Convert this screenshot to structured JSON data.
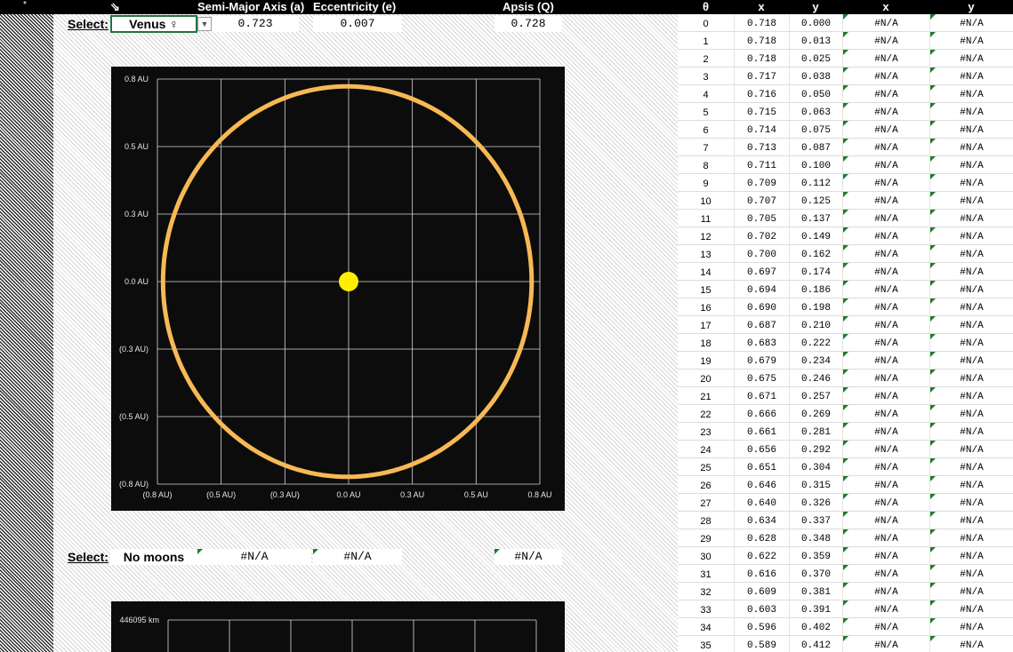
{
  "header": {
    "star": "*",
    "arrow": "⇘",
    "semi_major": "Semi-Major Axis (a)",
    "eccentricity": "Eccentricity (e)",
    "apsis": "Apsis (Q)",
    "col_theta": "θ",
    "col_x": "x",
    "col_y": "y",
    "col_x2": "x",
    "col_y2": "y"
  },
  "planet_row": {
    "select_label": "Select:",
    "selected": "Venus ♀",
    "a": "0.723",
    "e": "0.007",
    "Q": "0.728"
  },
  "moon_row": {
    "select_label": "Select:",
    "selected": "No moons",
    "a": "#N/A",
    "e": "#N/A",
    "Q": "#N/A"
  },
  "chart_data": [
    {
      "type": "scatter",
      "title": "",
      "xlabel": "",
      "ylabel": "",
      "xlim": [
        -0.75,
        0.75
      ],
      "ylim": [
        -0.75,
        0.75
      ],
      "x_ticks": [
        -0.75,
        -0.5,
        -0.25,
        0,
        0.25,
        0.5,
        0.75
      ],
      "y_ticks": [
        -0.75,
        -0.5,
        -0.25,
        0,
        0.25,
        0.5,
        0.75
      ],
      "x_tick_labels": [
        "(0.8 AU)",
        "(0.5 AU)",
        "(0.3 AU)",
        "0.0 AU",
        "0.3 AU",
        "0.5 AU",
        "0.8 AU"
      ],
      "y_tick_labels": [
        "(0.8 AU)",
        "(0.5 AU)",
        "(0.3 AU)",
        "0.0 AU",
        "0.3 AU",
        "0.5 AU",
        "0.8 AU"
      ],
      "grid": true,
      "series": [
        {
          "semi_major_axis": 0.723,
          "eccentricity": 0.007,
          "color": "#f7b955"
        },
        {
          "x": [
            0
          ],
          "y": [
            0
          ],
          "color": "#ffee00"
        }
      ]
    },
    {
      "type": "scatter",
      "title": "",
      "y_tick_labels": [
        "446095 km"
      ],
      "grid": true,
      "series": []
    }
  ],
  "table": {
    "rows": [
      {
        "t": "0",
        "x": "0.718",
        "y": "0.000",
        "x2": "#N/A",
        "y2": "#N/A"
      },
      {
        "t": "1",
        "x": "0.718",
        "y": "0.013",
        "x2": "#N/A",
        "y2": "#N/A"
      },
      {
        "t": "2",
        "x": "0.718",
        "y": "0.025",
        "x2": "#N/A",
        "y2": "#N/A"
      },
      {
        "t": "3",
        "x": "0.717",
        "y": "0.038",
        "x2": "#N/A",
        "y2": "#N/A"
      },
      {
        "t": "4",
        "x": "0.716",
        "y": "0.050",
        "x2": "#N/A",
        "y2": "#N/A"
      },
      {
        "t": "5",
        "x": "0.715",
        "y": "0.063",
        "x2": "#N/A",
        "y2": "#N/A"
      },
      {
        "t": "6",
        "x": "0.714",
        "y": "0.075",
        "x2": "#N/A",
        "y2": "#N/A"
      },
      {
        "t": "7",
        "x": "0.713",
        "y": "0.087",
        "x2": "#N/A",
        "y2": "#N/A"
      },
      {
        "t": "8",
        "x": "0.711",
        "y": "0.100",
        "x2": "#N/A",
        "y2": "#N/A"
      },
      {
        "t": "9",
        "x": "0.709",
        "y": "0.112",
        "x2": "#N/A",
        "y2": "#N/A"
      },
      {
        "t": "10",
        "x": "0.707",
        "y": "0.125",
        "x2": "#N/A",
        "y2": "#N/A"
      },
      {
        "t": "11",
        "x": "0.705",
        "y": "0.137",
        "x2": "#N/A",
        "y2": "#N/A"
      },
      {
        "t": "12",
        "x": "0.702",
        "y": "0.149",
        "x2": "#N/A",
        "y2": "#N/A"
      },
      {
        "t": "13",
        "x": "0.700",
        "y": "0.162",
        "x2": "#N/A",
        "y2": "#N/A"
      },
      {
        "t": "14",
        "x": "0.697",
        "y": "0.174",
        "x2": "#N/A",
        "y2": "#N/A"
      },
      {
        "t": "15",
        "x": "0.694",
        "y": "0.186",
        "x2": "#N/A",
        "y2": "#N/A"
      },
      {
        "t": "16",
        "x": "0.690",
        "y": "0.198",
        "x2": "#N/A",
        "y2": "#N/A"
      },
      {
        "t": "17",
        "x": "0.687",
        "y": "0.210",
        "x2": "#N/A",
        "y2": "#N/A"
      },
      {
        "t": "18",
        "x": "0.683",
        "y": "0.222",
        "x2": "#N/A",
        "y2": "#N/A"
      },
      {
        "t": "19",
        "x": "0.679",
        "y": "0.234",
        "x2": "#N/A",
        "y2": "#N/A"
      },
      {
        "t": "20",
        "x": "0.675",
        "y": "0.246",
        "x2": "#N/A",
        "y2": "#N/A"
      },
      {
        "t": "21",
        "x": "0.671",
        "y": "0.257",
        "x2": "#N/A",
        "y2": "#N/A"
      },
      {
        "t": "22",
        "x": "0.666",
        "y": "0.269",
        "x2": "#N/A",
        "y2": "#N/A"
      },
      {
        "t": "23",
        "x": "0.661",
        "y": "0.281",
        "x2": "#N/A",
        "y2": "#N/A"
      },
      {
        "t": "24",
        "x": "0.656",
        "y": "0.292",
        "x2": "#N/A",
        "y2": "#N/A"
      },
      {
        "t": "25",
        "x": "0.651",
        "y": "0.304",
        "x2": "#N/A",
        "y2": "#N/A"
      },
      {
        "t": "26",
        "x": "0.646",
        "y": "0.315",
        "x2": "#N/A",
        "y2": "#N/A"
      },
      {
        "t": "27",
        "x": "0.640",
        "y": "0.326",
        "x2": "#N/A",
        "y2": "#N/A"
      },
      {
        "t": "28",
        "x": "0.634",
        "y": "0.337",
        "x2": "#N/A",
        "y2": "#N/A"
      },
      {
        "t": "29",
        "x": "0.628",
        "y": "0.348",
        "x2": "#N/A",
        "y2": "#N/A"
      },
      {
        "t": "30",
        "x": "0.622",
        "y": "0.359",
        "x2": "#N/A",
        "y2": "#N/A"
      },
      {
        "t": "31",
        "x": "0.616",
        "y": "0.370",
        "x2": "#N/A",
        "y2": "#N/A"
      },
      {
        "t": "32",
        "x": "0.609",
        "y": "0.381",
        "x2": "#N/A",
        "y2": "#N/A"
      },
      {
        "t": "33",
        "x": "0.603",
        "y": "0.391",
        "x2": "#N/A",
        "y2": "#N/A"
      },
      {
        "t": "34",
        "x": "0.596",
        "y": "0.402",
        "x2": "#N/A",
        "y2": "#N/A"
      },
      {
        "t": "35",
        "x": "0.589",
        "y": "0.412",
        "x2": "#N/A",
        "y2": "#N/A"
      }
    ]
  }
}
